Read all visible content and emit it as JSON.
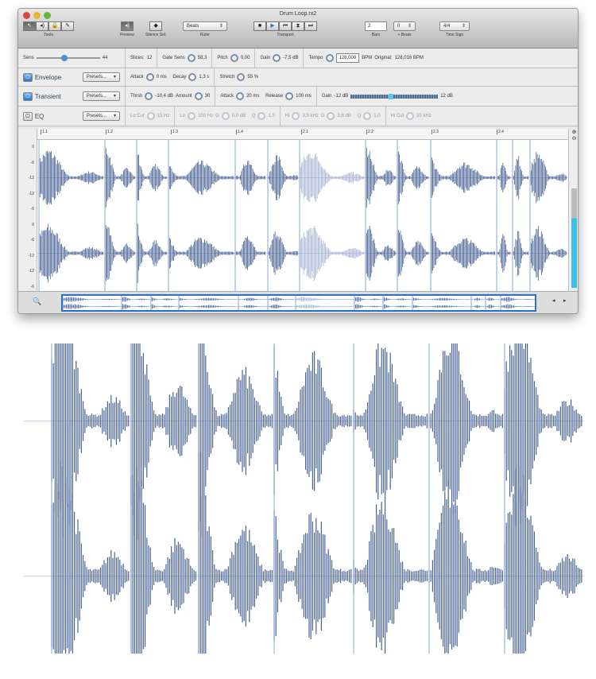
{
  "window": {
    "title": "Drum Loop.rx2"
  },
  "toolbar": {
    "tools_label": "Tools",
    "preview_label": "Preview",
    "silence_label": "Silence Sel.",
    "ruler_label": "Ruler",
    "ruler_value": "Beats",
    "transport_label": "Transport",
    "bars_value": "2",
    "bars_label": "Bars",
    "beats_value": "0",
    "beats_label": "+ Beats",
    "timesig_value": "4/4",
    "timesig_label": "Time Sign"
  },
  "params": {
    "sens_label": "Sens",
    "sens_value": "44",
    "sens_fraction": 0.44,
    "slices_label": "Slices:",
    "slices_value": "12",
    "gate_label": "Gate Sens",
    "gate_value": "58,3",
    "pitch_label": "Pitch",
    "pitch_value": "0,00",
    "gain_label": "Gain",
    "gain_value": "-7,5 dB",
    "tempo_label": "Tempo",
    "tempo_value": "128,000",
    "bpm_label": "BPM",
    "original_label": "Original:",
    "original_value": "128,016 BPM"
  },
  "envelope": {
    "label": "Envelope",
    "presets": "Presets...",
    "attack_label": "Attack",
    "attack_value": "0 ms",
    "decay_label": "Decay",
    "decay_value": "1,3 s",
    "stretch_label": "Stretch",
    "stretch_value": "55 %"
  },
  "transient": {
    "label": "Transient",
    "presets": "Presets...",
    "thrsh_label": "Thrsh",
    "thrsh_value": "-10,4 dB",
    "amount_label": "Amount",
    "amount_value": "30",
    "attack_label": "Attack",
    "attack_value": "20 ms",
    "release_label": "Release",
    "release_value": "100 ms",
    "gain_label": "Gain",
    "gain_min": "-12 dB",
    "gain_max": "12 dB"
  },
  "eq": {
    "label": "EQ",
    "presets": "Presets...",
    "locut_label": "Lo Cut",
    "locut_value": "15 Hz",
    "lo_label": "Lo",
    "lo_value": "100 Hz",
    "g1_label": "G",
    "g1_value": "0,0 dB",
    "q1_label": "Q",
    "q1_value": "1,0",
    "hi_label": "Hi",
    "hi_value": "3,5 kHz",
    "g2_label": "G",
    "g2_value": "3,6 dB",
    "q2_label": "Q",
    "q2_value": "1,0",
    "hicut_label": "Hi Cut",
    "hicut_value": "20 kHz"
  },
  "ruler_marks": [
    "1.1",
    "1.2",
    "1.3",
    "1.4",
    "2.1",
    "2.2",
    "2.3",
    "2.4"
  ],
  "y_ticks": [
    "0",
    "-6",
    "-12",
    "-12",
    "-6",
    "0",
    "-6",
    "-12",
    "-12",
    "-6"
  ],
  "colors": {
    "wave": "#4a6394",
    "slice": "#8aa0d8",
    "accent": "#3a8fd8"
  }
}
